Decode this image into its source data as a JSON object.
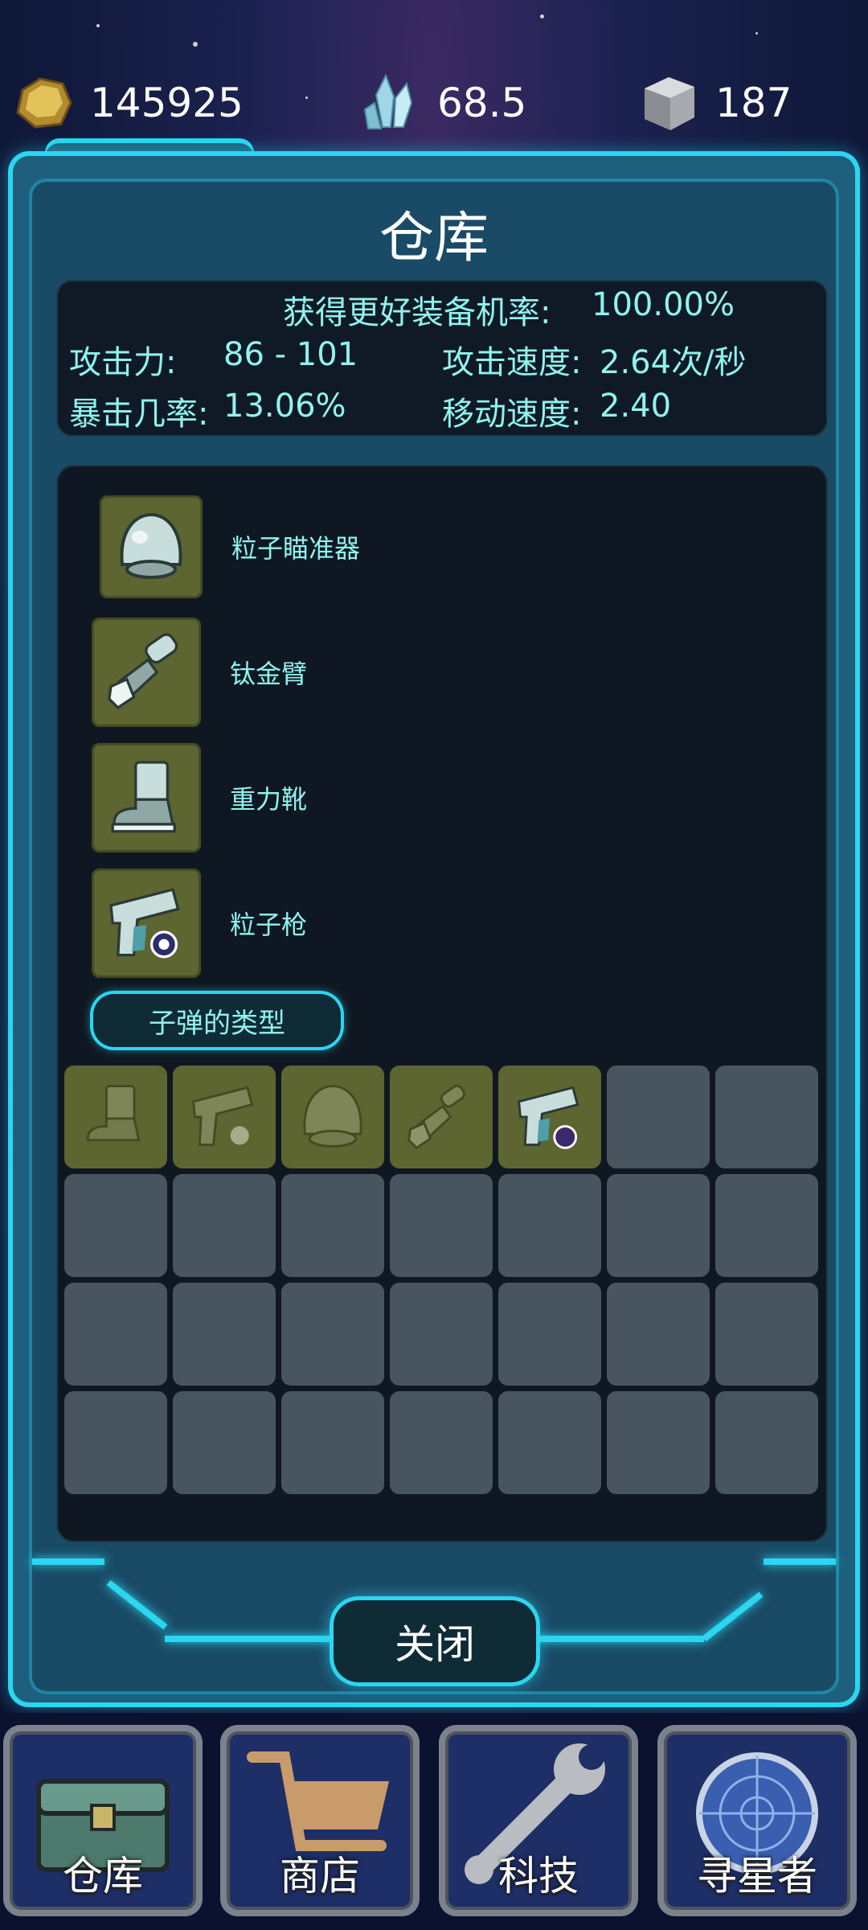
{
  "resources": {
    "gold": "145925",
    "crystal": "68.5",
    "metal": "187"
  },
  "panel": {
    "title": "仓库",
    "stats": {
      "better_gear_label": "获得更好装备机率:",
      "better_gear_value": "100.00%",
      "attack_label": "攻击力:",
      "attack_value": "86 - 101",
      "attack_speed_label": "攻击速度:",
      "attack_speed_value": "2.64次/秒",
      "crit_label": "暴击几率:",
      "crit_value": "13.06%",
      "move_speed_label": "移动速度:",
      "move_speed_value": "2.40"
    },
    "equipped": [
      {
        "label": "粒子瞄准器",
        "icon": "helmet-icon"
      },
      {
        "label": "钛金臂",
        "icon": "arm-glove-icon"
      },
      {
        "label": "重力靴",
        "icon": "boot-icon"
      },
      {
        "label": "粒子枪",
        "icon": "gun-icon"
      }
    ],
    "bullet_type_button": "子弹的类型",
    "inventory_items": [
      "boot-icon",
      "gun-icon",
      "helmet-icon",
      "arm-glove-icon",
      "gun-icon"
    ],
    "close_button": "关闭"
  },
  "nav": [
    {
      "label": "仓库",
      "icon": "chest-icon"
    },
    {
      "label": "商店",
      "icon": "cart-icon"
    },
    {
      "label": "科技",
      "icon": "wrench-icon"
    },
    {
      "label": "寻星者",
      "icon": "radar-icon"
    }
  ],
  "colors": {
    "accent": "#2ad6f0",
    "stat_text": "#8ff3ee",
    "item_slot": "#5d6530",
    "empty_slot": "#48555f"
  }
}
